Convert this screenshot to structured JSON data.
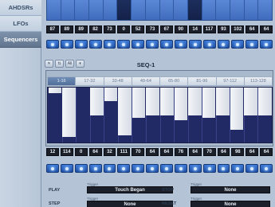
{
  "sidebar": {
    "items": [
      {
        "label": "AHDSRs",
        "active": false
      },
      {
        "label": "LFOs",
        "active": false
      },
      {
        "label": "Sequencers",
        "active": true
      }
    ]
  },
  "envelope_strip": {
    "cells": [
      {
        "value": "87",
        "level": 0.0
      },
      {
        "value": "89",
        "level": 0.0
      },
      {
        "value": "89",
        "level": 0.0
      },
      {
        "value": "82",
        "level": 0.0
      },
      {
        "value": "73",
        "level": 0.0
      },
      {
        "value": "0",
        "level": 1.0
      },
      {
        "value": "52",
        "level": 0.0
      },
      {
        "value": "73",
        "level": 0.0
      },
      {
        "value": "67",
        "level": 0.0
      },
      {
        "value": "90",
        "level": 0.0
      },
      {
        "value": "14",
        "level": 1.0
      },
      {
        "value": "117",
        "level": 0.0
      },
      {
        "value": "93",
        "level": 0.0
      },
      {
        "value": "102",
        "level": 0.0
      },
      {
        "value": "64",
        "level": 0.0
      },
      {
        "value": "64",
        "level": 0.0
      }
    ]
  },
  "toolbar": {
    "buttons": [
      {
        "label": "✕",
        "icon": "close-icon"
      },
      {
        "label": "⇅",
        "icon": "arrows-icon"
      },
      {
        "label": "All",
        "icon": "all-icon"
      },
      {
        "label": "▾",
        "icon": "dropdown-icon"
      }
    ]
  },
  "sequencer": {
    "title": "SEQ-1",
    "tabs": [
      "1-16",
      "17-32",
      "33-48",
      "49-64",
      "65-80",
      "81-96",
      "97-112",
      "113-128"
    ],
    "active_tab": 0,
    "steps": [
      {
        "value": "12"
      },
      {
        "value": "114"
      },
      {
        "value": "0"
      },
      {
        "value": "64"
      },
      {
        "value": "32"
      },
      {
        "value": "111"
      },
      {
        "value": "70"
      },
      {
        "value": "64"
      },
      {
        "value": "64"
      },
      {
        "value": "76"
      },
      {
        "value": "64"
      },
      {
        "value": "70"
      },
      {
        "value": "64"
      },
      {
        "value": "98"
      },
      {
        "value": "64"
      },
      {
        "value": "64"
      }
    ]
  },
  "triggers": {
    "play": {
      "caption": "PLAY",
      "sublabel": "Trigger",
      "value": "Touch Began"
    },
    "stop": {
      "caption": "STOP",
      "sublabel": "Trigger",
      "value": "None"
    },
    "step": {
      "caption": "STEP",
      "sublabel": "Trigger",
      "value": "None"
    },
    "reset": {
      "caption": "RESET",
      "sublabel": "Trigger",
      "value": "None"
    }
  },
  "colors": {
    "accent_blue": "#4a78c9",
    "grid_bg": "#222a66",
    "bar_fill": "#e8ecf2"
  }
}
